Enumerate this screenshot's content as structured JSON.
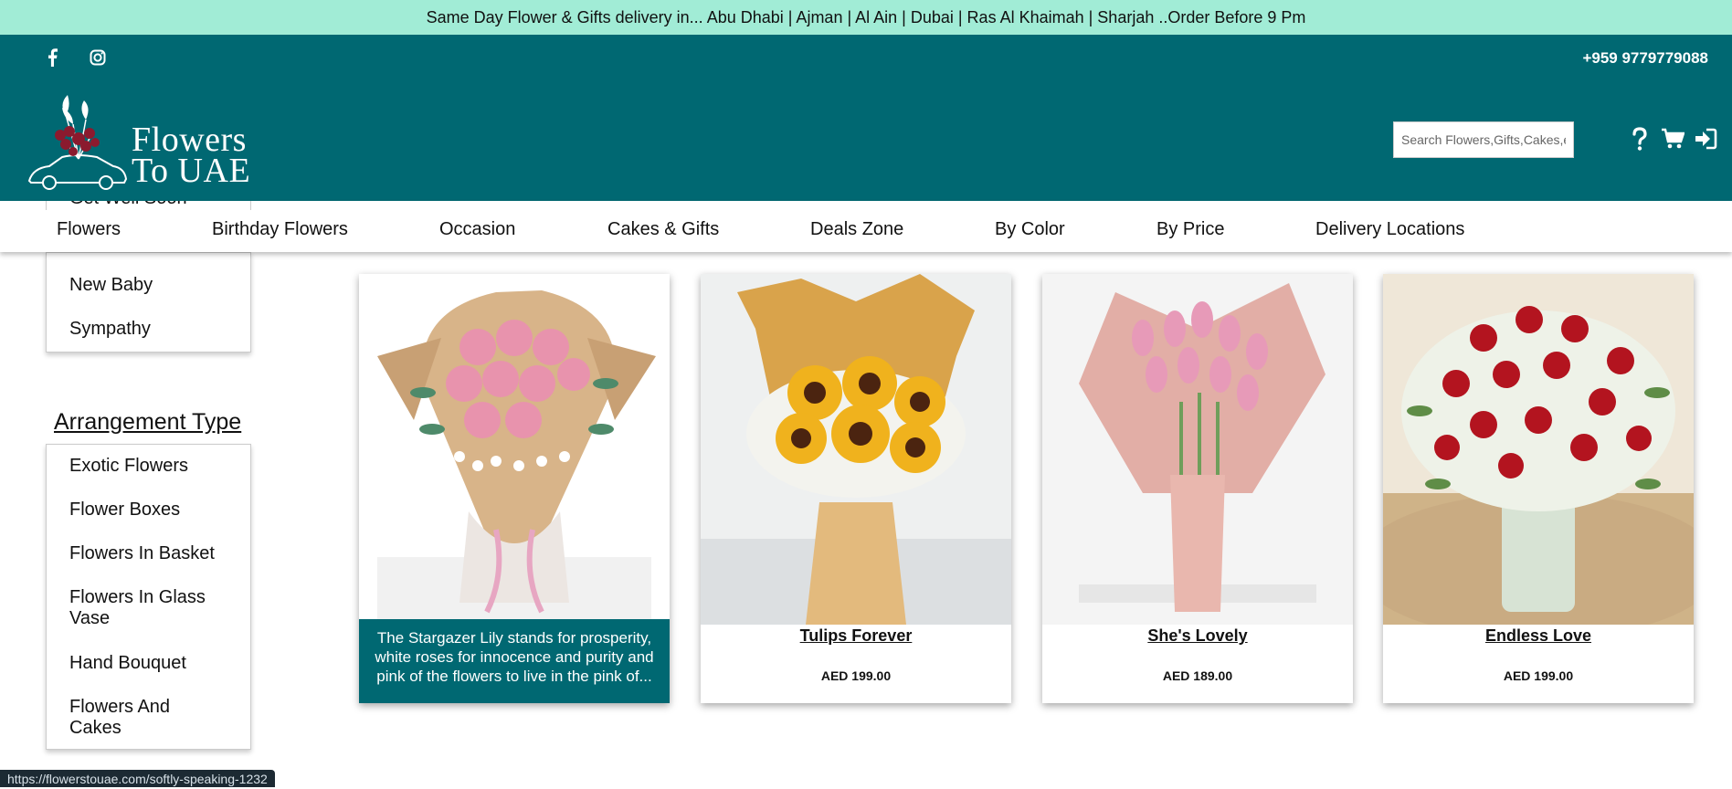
{
  "topbar": {
    "announcement": "Same Day Flower & Gifts delivery in... Abu Dhabi | Ajman | Al Ain | Dubai | Ras Al Khaimah | Sharjah ..Order Before 9 Pm"
  },
  "header": {
    "phone": "+959 9779779088",
    "logo_line1": "Flowers",
    "logo_line2": "To UAE",
    "search_placeholder": "Search Flowers,Gifts,Cakes,etc.",
    "social_icons": [
      "facebook-icon",
      "instagram-icon"
    ],
    "action_icons": [
      "help-icon",
      "cart-icon",
      "login-icon"
    ]
  },
  "nav": {
    "items": [
      "Flowers",
      "Birthday Flowers",
      "Occasion",
      "Cakes & Gifts",
      "Deals Zone",
      "By Color",
      "By Price",
      "Delivery Locations"
    ]
  },
  "sidebar": {
    "occasion_peek": "Get Well Soon",
    "occasion_items": [
      "New Baby",
      "Sympathy"
    ],
    "arrangement_heading": "Arrangement Type",
    "arrangement_items": [
      "Exotic Flowers",
      "Flower Boxes",
      "Flowers In Basket",
      "Flowers In Glass Vase",
      "Hand Bouquet",
      "Flowers And Cakes"
    ]
  },
  "products": [
    {
      "title": "",
      "price": "",
      "overlay": "The Stargazer Lily stands for prosperity, white roses for innocence and purity and pink of the flowers to live in the pink of..."
    },
    {
      "title": "Tulips Forever",
      "price": "AED 199.00"
    },
    {
      "title": "She's Lovely",
      "price": "AED 189.00"
    },
    {
      "title": "Endless Love",
      "price": "AED 199.00"
    }
  ],
  "status": {
    "url": "https://flowerstouae.com/softly-speaking-1232"
  },
  "colors": {
    "teal": "#006872",
    "mint": "#a1ecd6"
  }
}
